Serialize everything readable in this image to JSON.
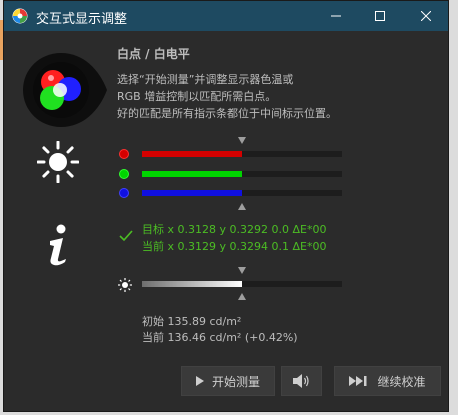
{
  "window": {
    "title": "交互式显示调整"
  },
  "heading": "白点 / 白电平",
  "description": [
    "选择“开始测量”并调整显示器色温或",
    "RGB 增益控制以匹配所需白点。",
    "好的匹配是所有指示条都位于中间标示位置。"
  ],
  "bars": [
    {
      "name": "red",
      "color": "#d40000",
      "fill_fraction": 0.5
    },
    {
      "name": "green",
      "color": "#00d400",
      "fill_fraction": 0.5
    },
    {
      "name": "blue",
      "color": "#1010e0",
      "fill_fraction": 0.5
    }
  ],
  "readings": {
    "target": "目标 x 0.3128 y 0.3292 0.0 ΔE*00",
    "current": "当前 x 0.3129 y 0.3294 0.1 ΔE*00"
  },
  "luminance": {
    "fill_fraction": 0.5,
    "initial": "初始 135.89 cd/m²",
    "current": "当前 136.46 cd/m² (+0.42%)"
  },
  "buttons": {
    "start": "开始测量",
    "continue": "继续校准"
  },
  "colors": {
    "titlebar": "#1e4a61",
    "background": "#2b2b2b",
    "text": "#bdbdbd",
    "ok_green": "#4cbd24"
  },
  "icons": [
    "app-icon",
    "minimize-icon",
    "maximize-icon",
    "close-icon",
    "rgb-logo-icon",
    "sun-icon",
    "info-icon",
    "check-icon",
    "small-sun-icon",
    "play-icon",
    "speaker-icon",
    "skip-forward-icon"
  ]
}
